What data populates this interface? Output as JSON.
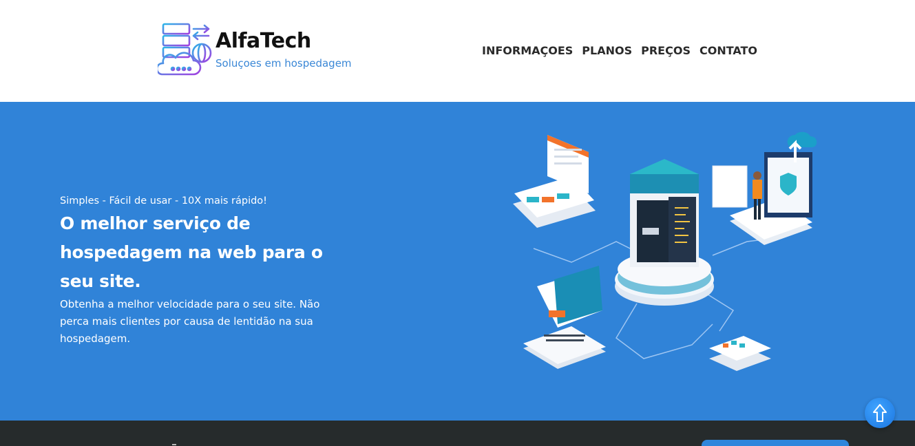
{
  "brand": {
    "name": "AlfaTech",
    "tagline": "Soluçoes em hospedagem"
  },
  "nav": {
    "items": [
      {
        "label": "INFORMAÇOES"
      },
      {
        "label": "PLANOS"
      },
      {
        "label": "PREÇOS"
      },
      {
        "label": "CONTATO"
      }
    ]
  },
  "hero": {
    "kicker": "Simples - Fácil de usar - 10X mais rápido!",
    "headline": "O melhor serviço de hospedagem na web para o seu site.",
    "subtext": "Obtenha a melhor velocidade para o seu site. Não perca mais clientes por causa de lentidão na sua hospedagem.",
    "illustration_icon": "server-network-illustration"
  },
  "colors": {
    "hero_bg": "#3083d8",
    "header_bg": "#ffffff",
    "footer_bg": "#262b2c",
    "accent": "#3a87d6",
    "logo_gradient_start": "#2bb5e8",
    "logo_gradient_end": "#a23fe0"
  },
  "icons": {
    "logo": "server-cloud-globe-icon",
    "scroll_top": "arrow-up-icon"
  }
}
